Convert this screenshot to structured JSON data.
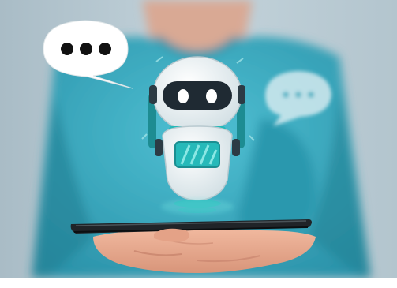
{
  "image": {
    "subject": "chatbot",
    "bubble_left": {
      "dots": 3,
      "icon": "typing-ellipsis-icon"
    },
    "bubble_right": {
      "dots": 3,
      "icon": "typing-ellipsis-icon"
    }
  },
  "colors": {
    "background": "#b7c9d2",
    "shirt": "#34a6bd",
    "skin": "#e6a88f",
    "robot_body": "#eef3f5",
    "robot_visor": "#1f2a33",
    "robot_accent": "#26b9b9",
    "phone": "#202428",
    "bubble": "#ffffff",
    "dot": "#111111"
  }
}
